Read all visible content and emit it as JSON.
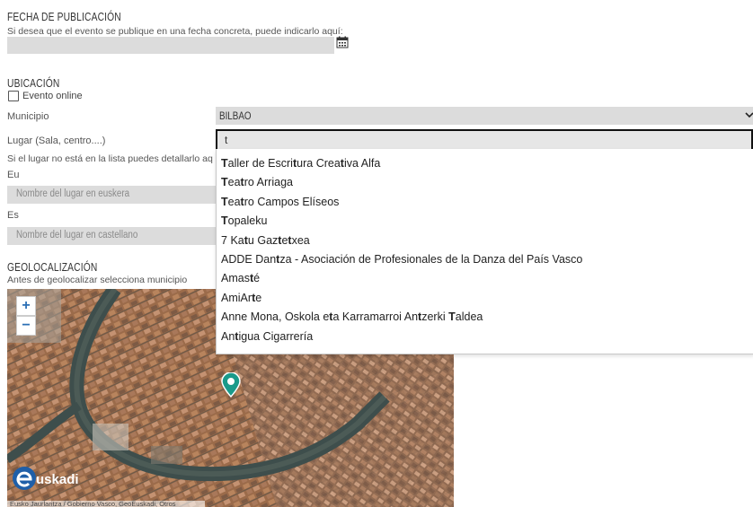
{
  "fecha": {
    "title": "FECHA DE PUBLICACIÓN",
    "help": "Si desea que el evento se publique en una fecha concreta, puede indicarlo aquí:",
    "calendar_icon": "calendar-icon"
  },
  "ubicacion": {
    "title": "UBICACIÓN",
    "online_label": "Evento online",
    "municipio_label": "Municipio",
    "municipio_value": "BILBAO",
    "lugar_label": "Lugar (Sala, centro....)",
    "lugar_value": "t",
    "note": "Si el lugar no está en la lista puedes detallarlo aq",
    "eu_label": "Eu",
    "eu_placeholder": "Nombre del lugar en euskera",
    "es_label": "Es",
    "es_placeholder": "Nombre del lugar en castellano"
  },
  "dropdown": {
    "items": [
      "Taller de Escritura Creativa Alfa",
      "Teatro Arriaga",
      "Teatro Campos Elíseos",
      "Topaleku",
      "7 Katu Gaztetxea",
      "ADDE Dantza - Asociación de Profesionales de la Danza del País Vasco",
      "Amasté",
      "AmiArte",
      "Anne Mona, Oskola eta Karramarroi Antzerki Taldea",
      "Antigua Cigarrería"
    ]
  },
  "geo": {
    "title": "GEOLOCALIZACIÓN",
    "help": "Antes de geolocalizar selecciona municipio",
    "zoom_in": "+",
    "zoom_out": "−",
    "logo_text": "uskadi",
    "attribution": "Eusko Jaurlaritza / Gobierno Vasco, GeoEuskadi, Otros"
  }
}
